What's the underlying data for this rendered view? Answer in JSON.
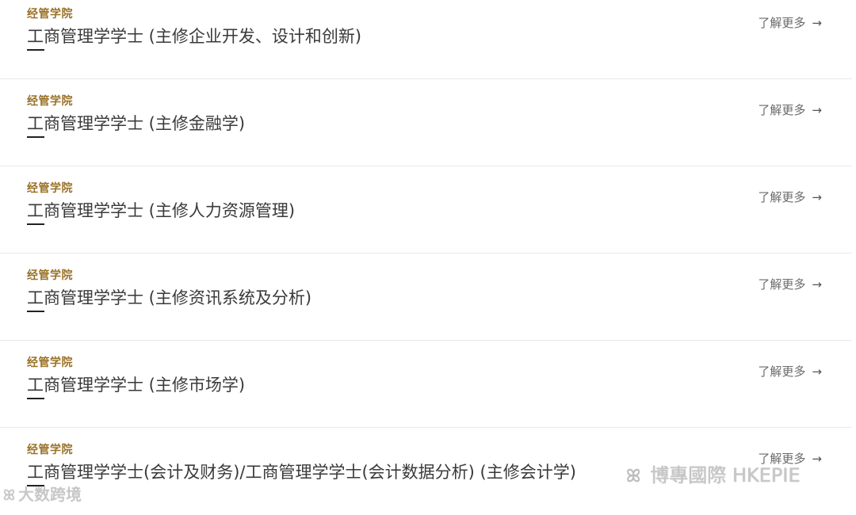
{
  "programs": [
    {
      "faculty": "经管学院",
      "title": "工商管理学学士 (主修企业开发、设计和创新)",
      "link": "了解更多",
      "arrow": "→"
    },
    {
      "faculty": "经管学院",
      "title": "工商管理学学士 (主修金融学)",
      "link": "了解更多",
      "arrow": "→"
    },
    {
      "faculty": "经管学院",
      "title": "工商管理学学士 (主修人力资源管理)",
      "link": "了解更多",
      "arrow": "→"
    },
    {
      "faculty": "经管学院",
      "title": "工商管理学学士 (主修资讯系统及分析)",
      "link": "了解更多",
      "arrow": "→"
    },
    {
      "faculty": "经管学院",
      "title": "工商管理学学士 (主修市场学)",
      "link": "了解更多",
      "arrow": "→"
    },
    {
      "faculty": "经管学院",
      "title": "工商管理学学士(会计及财务)/工商管理学学士(会计数据分析) (主修会计学)",
      "link": "了解更多",
      "arrow": "→"
    }
  ],
  "watermarks": {
    "left_text": "大数跨境",
    "right_text": "博專國際 HKEPIE"
  },
  "colors": {
    "faculty": "#9a7228",
    "title": "#3a3a3a",
    "link": "#6a6a6a",
    "divider": "#e8e8e8"
  }
}
